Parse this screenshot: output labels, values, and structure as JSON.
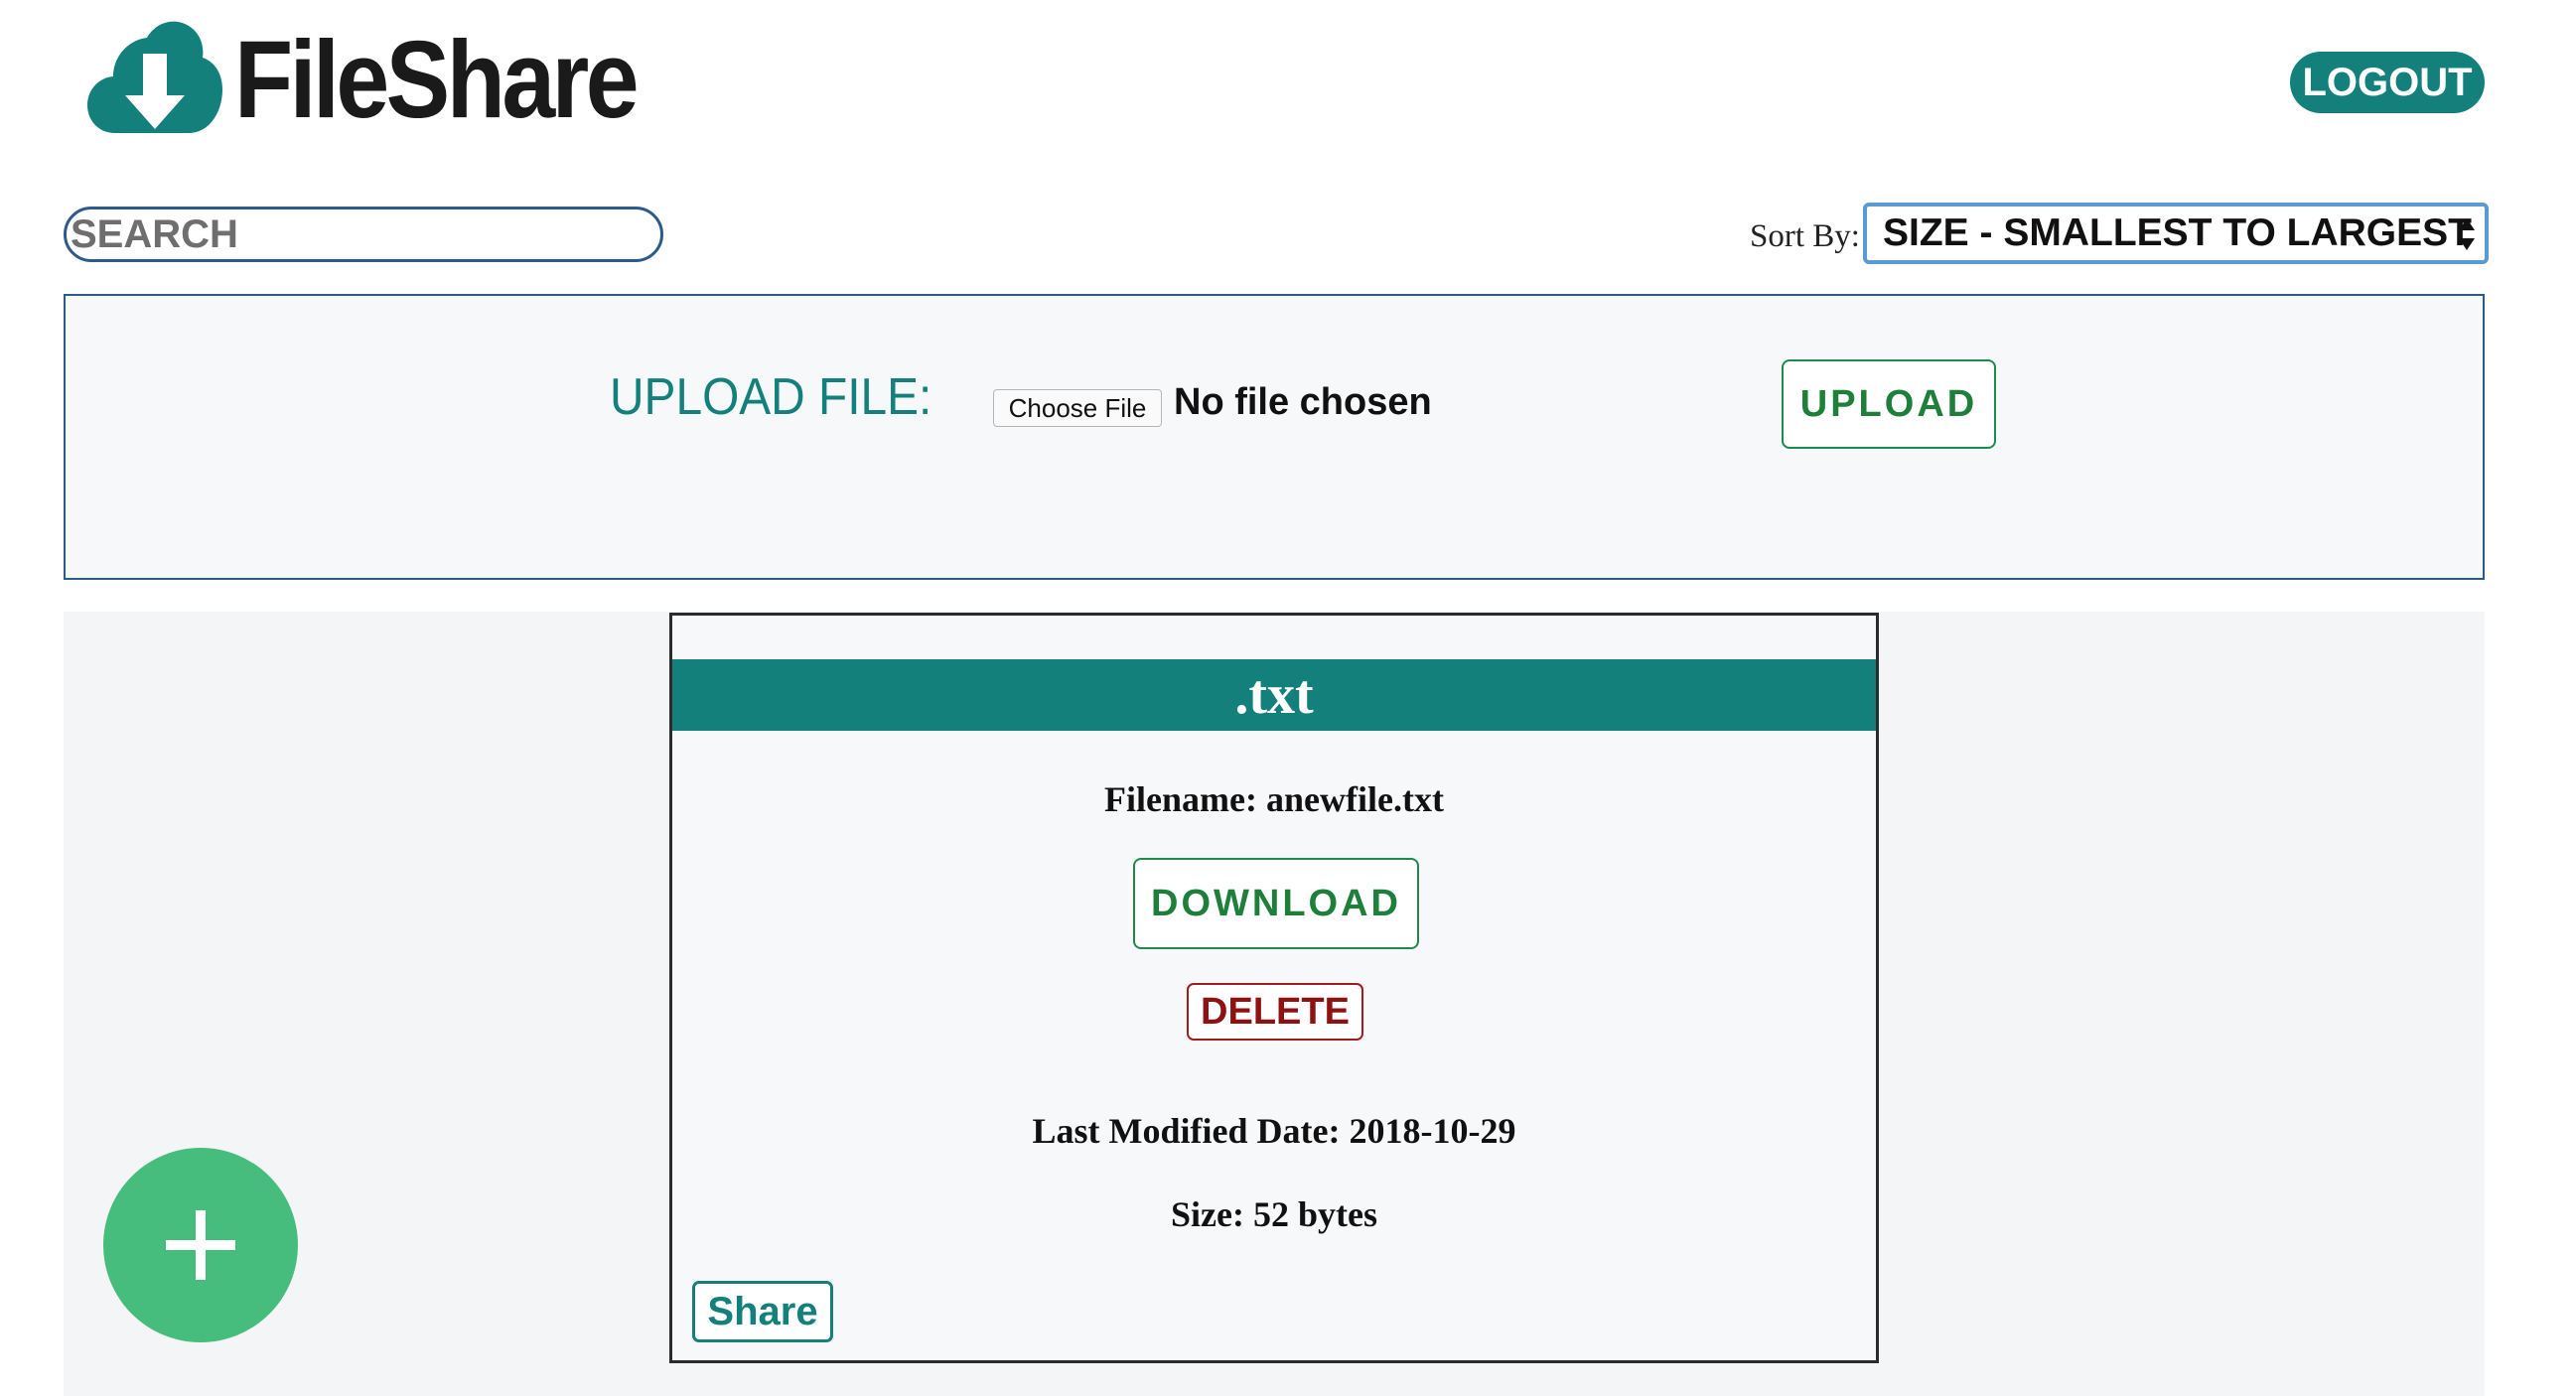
{
  "header": {
    "app_name": "FileShare",
    "logo_icon": "cloud-download-icon",
    "logout_label": "LOGOUT"
  },
  "toolbar": {
    "search_placeholder": "SEARCH",
    "search_value": "",
    "sort_label": "Sort By:",
    "sort_selected": "SIZE - SMALLEST TO LARGEST"
  },
  "upload": {
    "label": "UPLOAD FILE:",
    "choose_file_label": "Choose File",
    "no_file_text": "No file chosen",
    "upload_button_label": "UPLOAD"
  },
  "files": [
    {
      "extension": ".txt",
      "filename_text": "Filename: anewfile.txt",
      "download_label": "DOWNLOAD",
      "delete_label": "DELETE",
      "last_modified_text": "Last Modified Date: 2018-10-29",
      "size_text": "Size: 52 bytes",
      "share_label": "Share"
    }
  ],
  "fab": {
    "icon": "plus-icon"
  },
  "colors": {
    "teal": "#13807c",
    "green": "#1e7f3a",
    "red": "#8e1212",
    "fab_green": "#46bc7d",
    "panel_border": "#2d5a8c"
  }
}
